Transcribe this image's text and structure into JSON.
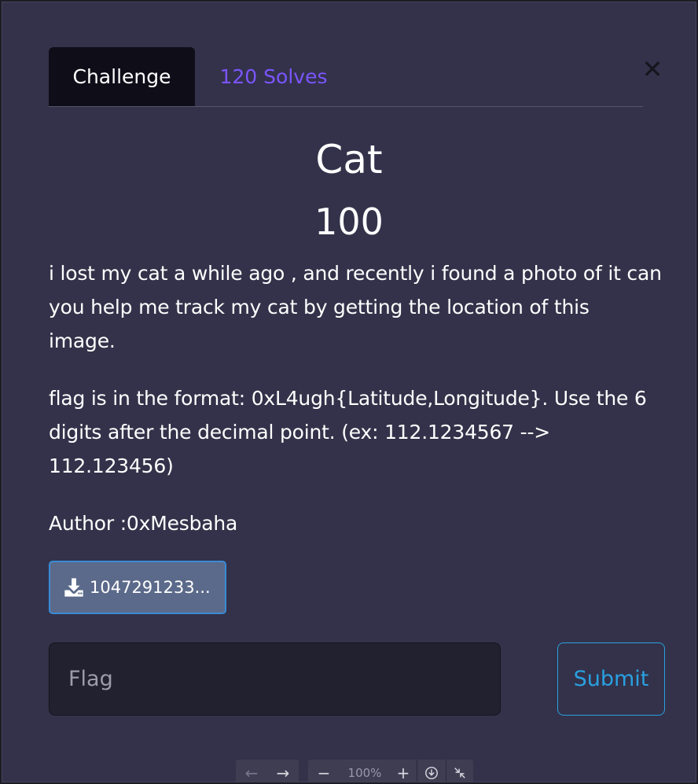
{
  "tabs": [
    {
      "label": "Challenge",
      "active": true
    },
    {
      "label": "120 Solves",
      "active": false
    }
  ],
  "close_icon": "close-icon",
  "challenge": {
    "name": "Cat",
    "points": "100",
    "description_1": "i lost my cat a while ago , and recently i found a photo of it can you help me track my cat by getting the location of this image.",
    "description_2": "flag is in the format: 0xL4ugh{Latitude,Longitude}. Use the 6 digits after the decimal point. (ex: 112.1234567 --> 112.123456)",
    "author": "Author :0xMesbaha"
  },
  "download": {
    "label": "1047291233...",
    "icon": "download-icon"
  },
  "flag_form": {
    "placeholder": "Flag",
    "value": "",
    "submit_label": "Submit"
  },
  "viewer_toolbar": {
    "zoom_level": "100%",
    "icons": [
      "arrow-left-icon",
      "arrow-right-icon",
      "zoom-out-icon",
      "zoom-in-icon",
      "download-circle-icon",
      "collapse-icon"
    ]
  },
  "colors": {
    "modal_bg": "#33324a",
    "active_tab_bg": "#0e0d18",
    "solves_tab": "#7b55ff",
    "download_button_bg": "#5b6a8a",
    "download_button_border": "#3a8bd6",
    "submit_accent": "#2aa0e0"
  }
}
